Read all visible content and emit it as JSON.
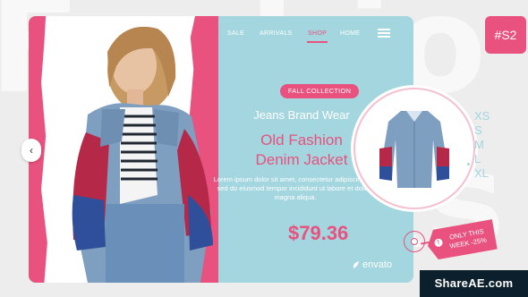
{
  "background": {
    "words": [
      "Fashio",
      "looks"
    ]
  },
  "nav": {
    "items": [
      {
        "label": "SALE"
      },
      {
        "label": "ARRIVALS"
      },
      {
        "label": "SHOP",
        "active": true
      },
      {
        "label": "HOME"
      }
    ],
    "menu_icon": "hamburger-menu-icon"
  },
  "badge": {
    "label": "FALL COLLECTION"
  },
  "product": {
    "brand": "Jeans Brand Wear",
    "name_line1": "Old Fashion",
    "name_line2": "Denim Jacket",
    "description": "Lorem ipsum dolor sit amet, consectetur adipiscing elit, sed do eiusmod tempor incididunt ut labore et dolore magna aliqua.",
    "price": "$79.36"
  },
  "sizes": {
    "options": [
      "XS",
      "S",
      "M",
      "L",
      "XL"
    ],
    "selected": "L"
  },
  "slide_tag": {
    "label": "#S2"
  },
  "promo": {
    "line1": "ONLY THIS",
    "line2": "WEEK -25%",
    "icon_label": "!"
  },
  "brand_mark": {
    "label": "envato",
    "icon": "envato-leaf-icon"
  },
  "prev_button": {
    "icon": "chevron-left-icon",
    "glyph": "‹"
  },
  "watermark": {
    "label": "ShareAE.com"
  },
  "colors": {
    "accent": "#e9517e",
    "panel": "#a3d6df",
    "page": "#ededed"
  }
}
